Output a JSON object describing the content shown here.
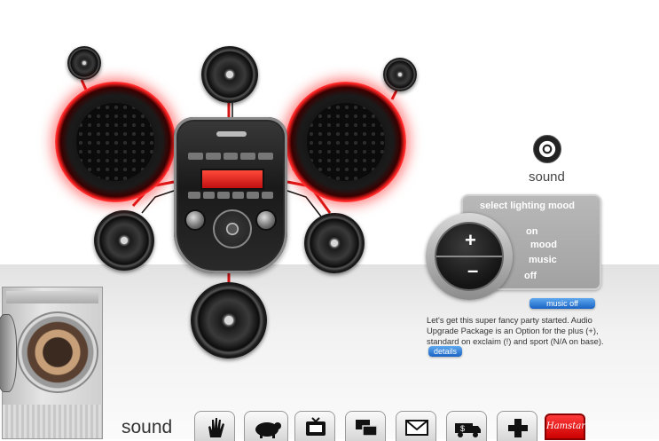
{
  "sound_section": {
    "icon": "speaker-icon",
    "label": "sound"
  },
  "lighting": {
    "title": "select lighting mood",
    "options": [
      "on",
      "mood",
      "music",
      "off"
    ],
    "plus": "+",
    "minus": "–"
  },
  "music_button": "music off",
  "info": {
    "text": "Let's get this super fancy party started. Audio Upgrade Package is an Option for the plus (+), standard on exclaim (!) and sport (N/A on base).",
    "details_button": "details"
  },
  "bottom_nav": {
    "label": "sound",
    "items": [
      {
        "icon": "hand-icon"
      },
      {
        "icon": "hamster-icon"
      },
      {
        "icon": "tv-icon"
      },
      {
        "icon": "windows-icon"
      },
      {
        "icon": "envelope-icon"
      },
      {
        "icon": "truck-dollar-icon"
      },
      {
        "icon": "dpad-icon"
      }
    ],
    "brand": "Hamstar"
  },
  "colors": {
    "accent_red": "#ff2020",
    "button_blue": "#1a64c4"
  }
}
